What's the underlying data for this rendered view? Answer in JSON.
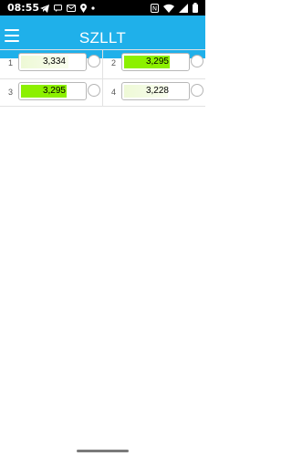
{
  "status_bar": {
    "time": "08:55",
    "left_icons": [
      "telegram-icon",
      "message-icon",
      "mail-icon",
      "location-icon",
      "dot-icon"
    ],
    "right_icons": [
      "nfc-icon",
      "wifi-icon",
      "signal-icon",
      "battery-icon"
    ]
  },
  "app_bar": {
    "title": "SZLLT",
    "color": "#1fb0ea"
  },
  "cells": [
    {
      "index": "1",
      "value": "3,334",
      "highlight": "pale",
      "fill_color": "#eef9d6",
      "fill_fraction": 0.75
    },
    {
      "index": "2",
      "value": "3,295",
      "highlight": "green",
      "fill_color": "#8cf000",
      "fill_fraction": 0.72
    },
    {
      "index": "3",
      "value": "3,295",
      "highlight": "green",
      "fill_color": "#8cf000",
      "fill_fraction": 0.72
    },
    {
      "index": "4",
      "value": "3,228",
      "highlight": "pale",
      "fill_color": "#eef9d6",
      "fill_fraction": 0.7
    }
  ]
}
